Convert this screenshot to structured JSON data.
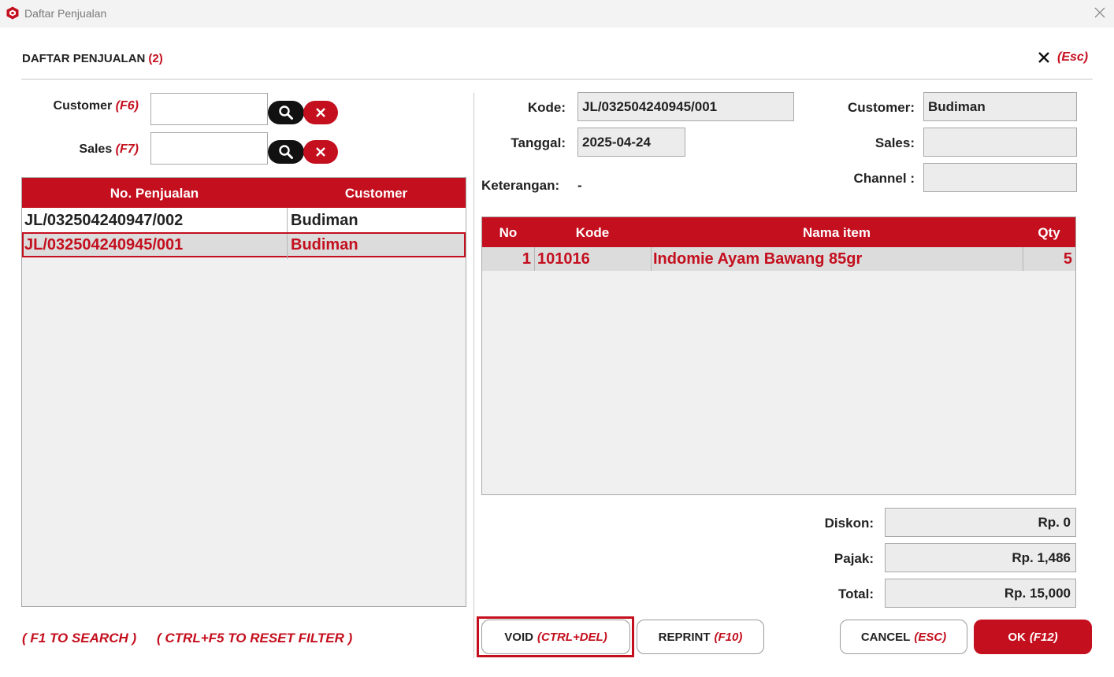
{
  "window": {
    "title": "Daftar Penjualan"
  },
  "header": {
    "title": "DAFTAR PENJUALAN",
    "count": "(2)",
    "close_hotkey": "(Esc)"
  },
  "filters": {
    "customer_label": "Customer",
    "customer_hotkey": "(F6)",
    "customer_value": "",
    "sales_label": "Sales",
    "sales_hotkey": "(F7)",
    "sales_value": ""
  },
  "sales_list": {
    "columns": [
      "No. Penjualan",
      "Customer"
    ],
    "rows": [
      {
        "no": "JL/032504240947/002",
        "customer": "Budiman"
      },
      {
        "no": "JL/032504240945/001",
        "customer": "Budiman"
      }
    ]
  },
  "hints": {
    "search": "( F1 TO SEARCH )",
    "reset": "( CTRL+F5 TO RESET FILTER )"
  },
  "detail": {
    "kode_label": "Kode:",
    "kode_value": "JL/032504240945/001",
    "tanggal_label": "Tanggal:",
    "tanggal_value": "2025-04-24",
    "keterangan_label": "Keterangan:",
    "keterangan_value": "-",
    "customer_label": "Customer:",
    "customer_value": "Budiman",
    "sales_label": "Sales:",
    "sales_value": "",
    "channel_label": "Channel :",
    "channel_value": ""
  },
  "items": {
    "columns": [
      "No",
      "Kode",
      "Nama item",
      "Qty"
    ],
    "rows": [
      {
        "no": "1",
        "kode": "101016",
        "nama": "Indomie Ayam Bawang 85gr",
        "qty": "5"
      }
    ]
  },
  "totals": {
    "diskon_label": "Diskon:",
    "diskon_value": "Rp. 0",
    "pajak_label": "Pajak:",
    "pajak_value": "Rp. 1,486",
    "total_label": "Total:",
    "total_value": "Rp. 15,000"
  },
  "buttons": {
    "void_label": "VOID",
    "void_hotkey": "(CTRL+DEL)",
    "reprint_label": "REPRINT",
    "reprint_hotkey": "(F10)",
    "cancel_label": "CANCEL",
    "cancel_hotkey": "(ESC)",
    "ok_label": "OK",
    "ok_hotkey": "(F12)"
  },
  "colors": {
    "accent": "#c40f1e",
    "grid_bg": "#f0f0f0",
    "selected_row": "#dcdcdc"
  }
}
